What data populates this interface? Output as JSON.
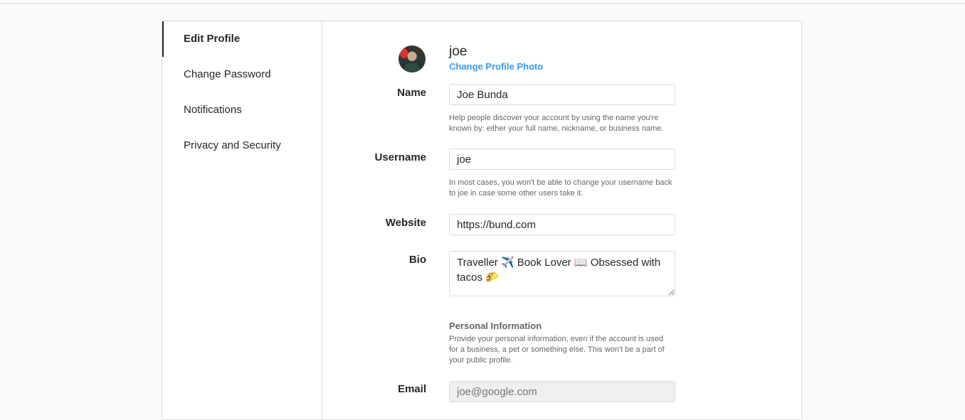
{
  "sidebar": {
    "items": [
      {
        "label": "Edit Profile"
      },
      {
        "label": "Change Password"
      },
      {
        "label": "Notifications"
      },
      {
        "label": "Privacy and Security"
      }
    ]
  },
  "profile": {
    "username_heading": "joe",
    "change_photo_label": "Change Profile Photo"
  },
  "form": {
    "name": {
      "label": "Name",
      "value": "Joe Bunda",
      "help": "Help people discover your account by using the name you're known by: either your full name, nickname, or business name."
    },
    "username": {
      "label": "Username",
      "value": "joe",
      "help": "In most cases, you won't be able to change your username back to joe in case some other users take it."
    },
    "website": {
      "label": "Website",
      "value": "https://bund.com"
    },
    "bio": {
      "label": "Bio",
      "value": "Traveller ✈️ Book Lover 📖 Obsessed with tacos 🌮"
    },
    "personal_info": {
      "title": "Personal Information",
      "help": "Provide your personal information, even if the account is used for a business, a pet or something else. This won't be a part of your public profile."
    },
    "email": {
      "label": "Email",
      "placeholder": "joe@google.com"
    }
  }
}
